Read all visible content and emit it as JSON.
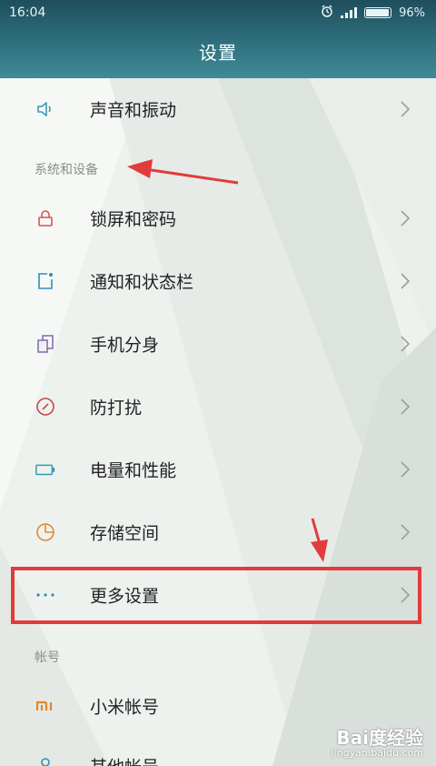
{
  "status_bar": {
    "time": "16:04",
    "battery": "96%",
    "battery_level": 0.96
  },
  "header": {
    "title": "设置"
  },
  "sections": {
    "system": "系统和设备",
    "account": "帐号"
  },
  "items": [
    {
      "label": "声音和振动",
      "icon": "speaker-icon"
    },
    {
      "label": "锁屏和密码",
      "icon": "lock-icon"
    },
    {
      "label": "通知和状态栏",
      "icon": "notification-icon"
    },
    {
      "label": "手机分身",
      "icon": "dual-phone-icon"
    },
    {
      "label": "防打扰",
      "icon": "do-not-disturb-icon"
    },
    {
      "label": "电量和性能",
      "icon": "battery-icon"
    },
    {
      "label": "存储空间",
      "icon": "storage-pie-icon"
    },
    {
      "label": "更多设置",
      "icon": "more-dots-icon"
    },
    {
      "label": "小米帐号",
      "icon": "mi-logo-icon"
    },
    {
      "label": "其他帐号",
      "icon": "person-icon"
    }
  ],
  "watermark": {
    "logo": "Bai度经验",
    "url": "jingyan.baidu.com"
  },
  "colors": {
    "annotation_red": "#e23b3b",
    "header_teal": "#2c6a78"
  }
}
